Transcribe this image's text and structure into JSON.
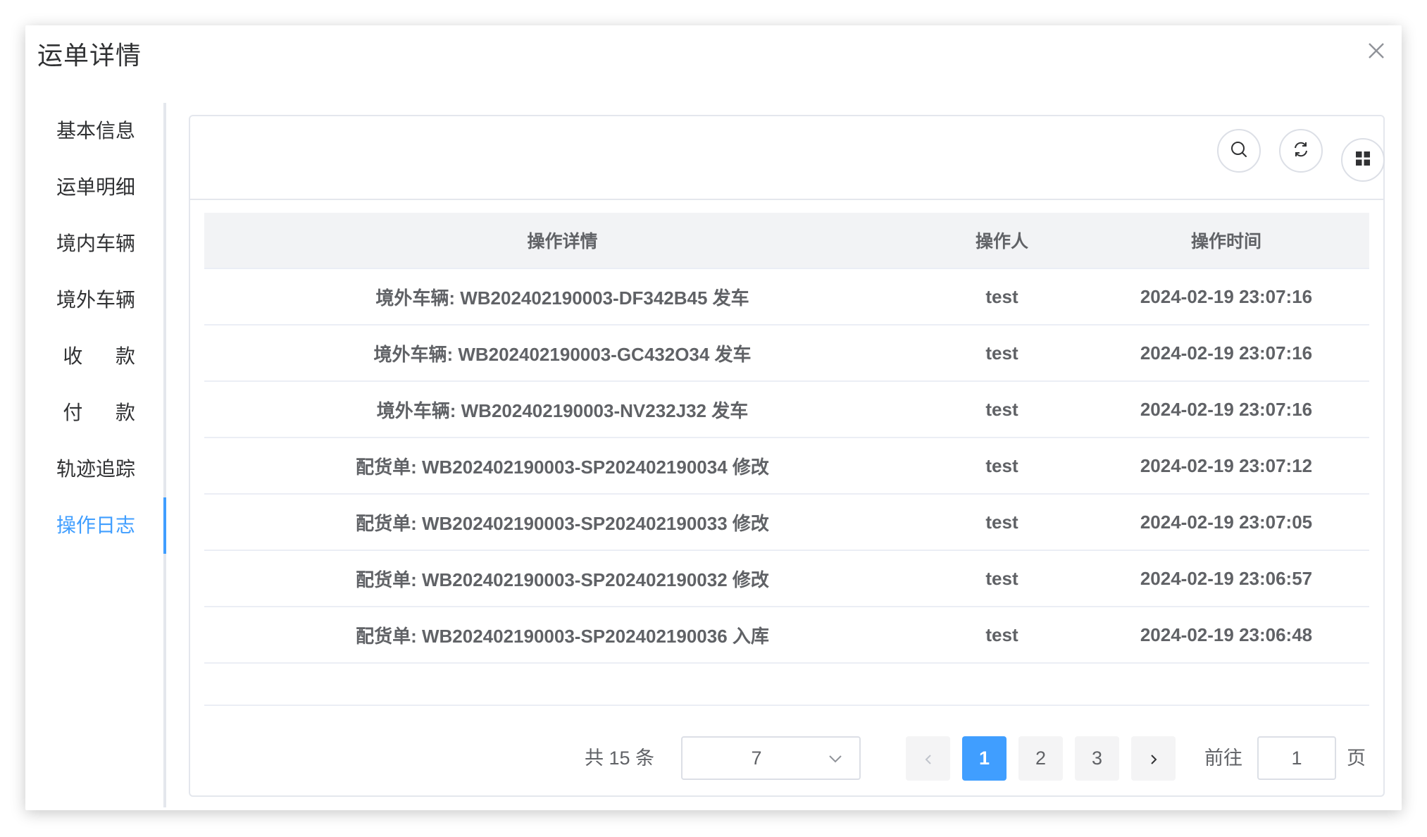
{
  "dialog": {
    "title": "运单详情"
  },
  "sidenav": {
    "items": [
      {
        "label": "基本信息"
      },
      {
        "label": "运单明细"
      },
      {
        "label": "境内车辆"
      },
      {
        "label": "境外车辆"
      },
      {
        "label": "收      款"
      },
      {
        "label": "付      款"
      },
      {
        "label": "轨迹追踪"
      },
      {
        "label": "操作日志"
      }
    ],
    "active_index": 7
  },
  "toolbar": {
    "icons": [
      "search-icon",
      "refresh-icon",
      "grid-icon"
    ]
  },
  "table": {
    "columns": [
      "操作详情",
      "操作人",
      "操作时间"
    ],
    "rows": [
      [
        "境外车辆: WB202402190003-DF342B45 发车",
        "test",
        "2024-02-19 23:07:16"
      ],
      [
        "境外车辆: WB202402190003-GC432O34 发车",
        "test",
        "2024-02-19 23:07:16"
      ],
      [
        "境外车辆: WB202402190003-NV232J32 发车",
        "test",
        "2024-02-19 23:07:16"
      ],
      [
        "配货单: WB202402190003-SP202402190034 修改",
        "test",
        "2024-02-19 23:07:12"
      ],
      [
        "配货单: WB202402190003-SP202402190033 修改",
        "test",
        "2024-02-19 23:07:05"
      ],
      [
        "配货单: WB202402190003-SP202402190032 修改",
        "test",
        "2024-02-19 23:06:57"
      ],
      [
        "配货单: WB202402190003-SP202402190036 入库",
        "test",
        "2024-02-19 23:06:48"
      ]
    ]
  },
  "pagination": {
    "total_text": "共 15 条",
    "page_size": "7",
    "pages": [
      "1",
      "2",
      "3"
    ],
    "current_page": "1",
    "goto_label": "前往",
    "goto_value": "1",
    "page_suffix": "页"
  },
  "colors": {
    "accent": "#409eff",
    "text": "#606266",
    "border": "#dcdfe6"
  }
}
